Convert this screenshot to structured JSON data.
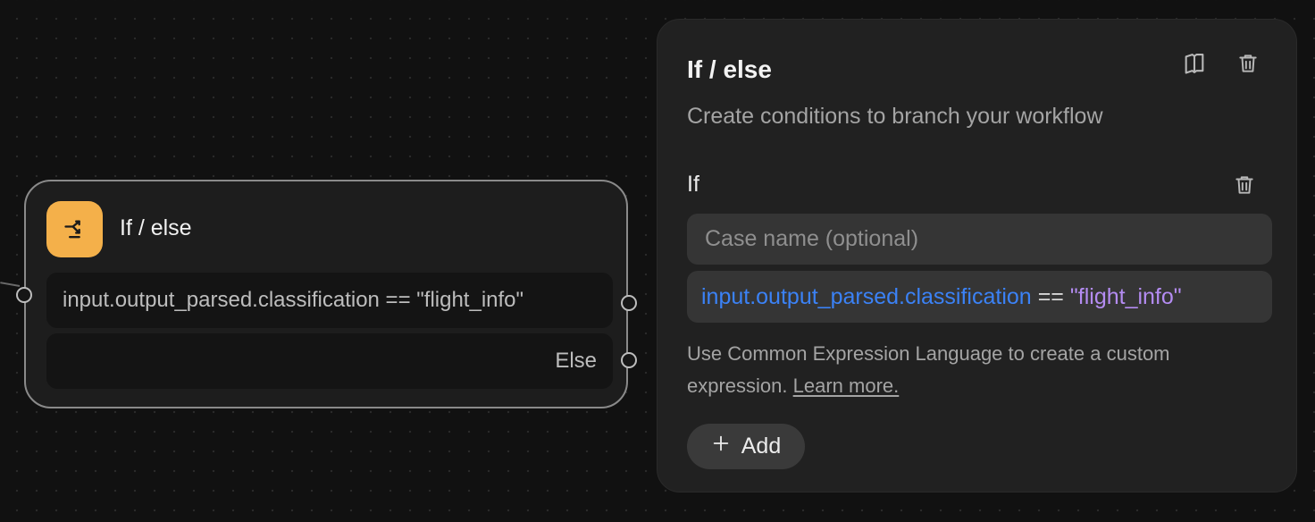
{
  "node": {
    "title": "If / else",
    "condition": "input.output_parsed.classification == \"flight_info\"",
    "else_label": "Else",
    "icon": "branch-icon",
    "icon_color": "#f4b04a"
  },
  "panel": {
    "title": "If / else",
    "subtitle": "Create conditions to branch your workflow",
    "header_icons": [
      "book-icon",
      "trash-icon"
    ],
    "case": {
      "label": "If",
      "name_placeholder": "Case name (optional)",
      "expression": {
        "identifier": "input.output_parsed.classification",
        "operator": "==",
        "value": "\"flight_info\""
      }
    },
    "help_text": "Use Common Expression Language to create a custom expression.",
    "learn_more": "Learn more.",
    "add_label": "Add"
  },
  "colors": {
    "background": "#111111",
    "panel": "#212121",
    "identifier": "#3b82f6",
    "string": "#b48cf2",
    "accent": "#f4b04a"
  }
}
